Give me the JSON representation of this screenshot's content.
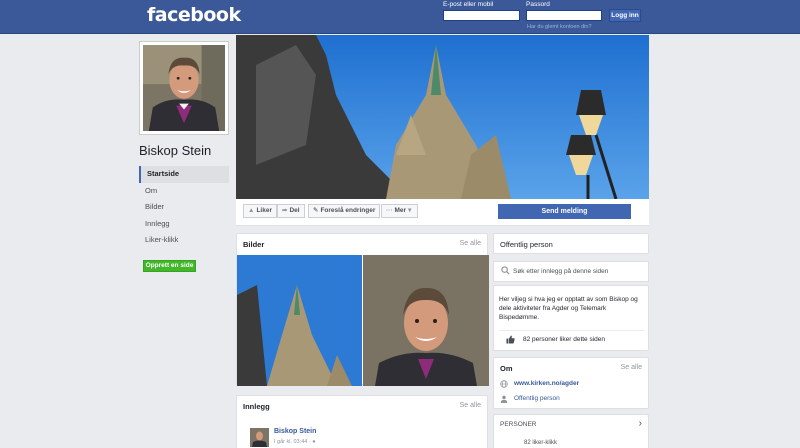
{
  "topbar": {
    "logo": "facebook",
    "email_label": "E-post eller mobil",
    "password_label": "Passord",
    "login_button": "Logg inn",
    "forgot_link": "Har du glemt kontoen din?"
  },
  "page": {
    "name": "Biskop Stein"
  },
  "leftnav": {
    "items": [
      {
        "label": "Startside"
      },
      {
        "label": "Om"
      },
      {
        "label": "Bilder"
      },
      {
        "label": "Innlegg"
      },
      {
        "label": "Liker-klikk"
      }
    ],
    "create_page": "Opprett en side"
  },
  "actions": {
    "like": "Liker",
    "share": "Del",
    "suggest": "Foreslå endringer",
    "more": "Mer",
    "send_message": "Send melding"
  },
  "photos_card": {
    "title": "Bilder",
    "see_all": "Se alle"
  },
  "posts_card": {
    "title": "Innlegg",
    "see_all": "Se alle",
    "author": "Biskop Stein",
    "time": "I går kl. 03:44 ·"
  },
  "sidebar": {
    "category": "Offentlig person",
    "search_placeholder": "Søk etter innlegg på denne siden",
    "about_text": "Her viljeg si hva jeg er opptatt av som Biskop og dele aktiviteter fra Agder og Telemark Bispedømme.",
    "likes_text": "82 personer liker dette siden",
    "om_title": "Om",
    "om_see_all": "Se alle",
    "website": "www.kirken.no/agder",
    "om_category": "Offentlig person",
    "persons_title": "PERSONER",
    "persons_count": "82 liker-klikk"
  },
  "colors": {
    "brand": "#3b5998",
    "button_blue": "#4267b2",
    "create_green": "#42b72a",
    "sky": "#2f7fd8"
  }
}
